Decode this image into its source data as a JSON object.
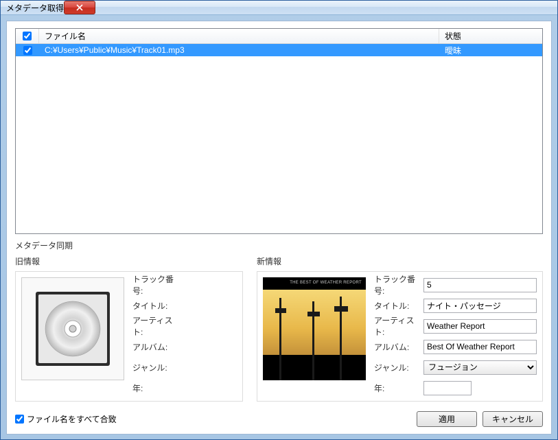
{
  "window": {
    "title": "メタデータ取得"
  },
  "list": {
    "headers": {
      "filename": "ファイル名",
      "status": "状態"
    },
    "rows": [
      {
        "filename": "C:¥Users¥Public¥Music¥Track01.mp3",
        "status": "曖昧",
        "checked": true,
        "selected": true
      }
    ]
  },
  "sync_label": "メタデータ同期",
  "old_section": {
    "title": "旧情報",
    "labels": {
      "track_no": "トラック番号:",
      "title": "タイトル:",
      "artist": "アーティスト:",
      "album": "アルバム:",
      "genre": "ジャンル:",
      "year": "年:"
    },
    "values": {
      "track_no": "",
      "title": "",
      "artist": "",
      "album": "",
      "genre": "",
      "year": ""
    }
  },
  "new_section": {
    "title": "新情報",
    "album_art_text": "THE BEST OF WEATHER REPORT",
    "labels": {
      "track_no": "トラック番号:",
      "title": "タイトル:",
      "artist": "アーティスト:",
      "album": "アルバム:",
      "genre": "ジャンル:",
      "year": "年:"
    },
    "values": {
      "track_no": "5",
      "title": "ナイト・パッセージ",
      "artist": "Weather Report",
      "album": "Best Of Weather Report",
      "genre": "フュージョン",
      "year": ""
    }
  },
  "footer": {
    "match_all": "ファイル名をすべて合致",
    "apply": "適用",
    "cancel": "キャンセル"
  }
}
